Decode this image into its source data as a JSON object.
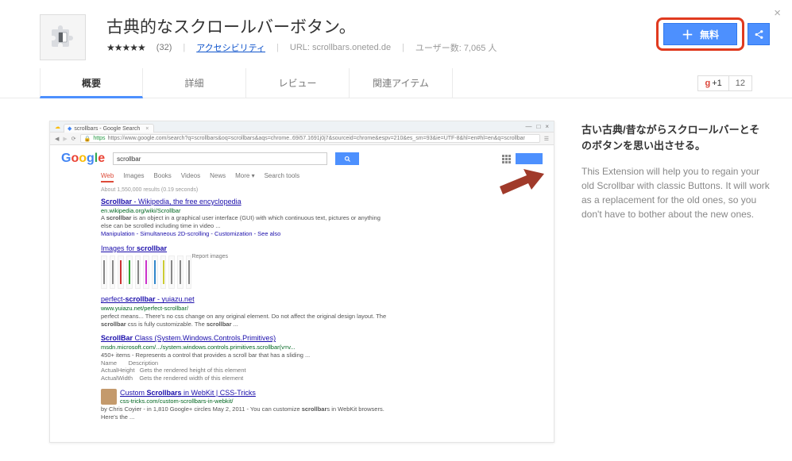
{
  "header": {
    "title": "古典的なスクロールバーボタン。",
    "reviews_count": "(32)",
    "category_link": "アクセシビリティ",
    "url_label": "URL:",
    "url_value": "scrollbars.oneted.de",
    "users_label": "ユーザー数: 7,065 人",
    "install_label": "無料",
    "gplus_label": "+1",
    "gplus_count": "12"
  },
  "tabs": {
    "overview": "概要",
    "details": "詳細",
    "reviews": "レビュー",
    "related": "関連アイテム"
  },
  "screenshot": {
    "tab_title": "scrollbars - Google Search",
    "address_url": "https://www.google.com/search?q=scrollbars&oq=scrollbars&aqs=chrome..69i57.1691j0j7&sourceid=chrome&espv=210&es_sm=93&ie=UTF-8&hl=en#hl=en&q=scrollbar",
    "search_value": "scrollbar",
    "nav": {
      "web": "Web",
      "images": "Images",
      "books": "Books",
      "videos": "Videos",
      "news": "News",
      "more": "More ▾",
      "tools": "Search tools"
    },
    "stats": "About 1,550,000 results (0.19 seconds)",
    "results": [
      {
        "title_before": "",
        "title_bold": "Scrollbar",
        "title_after": " - Wikipedia, the free encyclopedia",
        "url": "en.wikipedia.org/wiki/Scrollbar",
        "desc": "A scrollbar is an object in a graphical user interface (GUI) with which continuous text, pictures or anything else can be scrolled including time in video ...",
        "links": "Manipulation - Simultaneous 2D-scrolling - Customization - See also"
      },
      {
        "title_before": "Images for ",
        "title_bold": "scrollbar",
        "title_after": "",
        "url": "",
        "desc": "",
        "extra": "Report images",
        "images": true
      },
      {
        "title_before": "perfect-",
        "title_bold": "scrollbar",
        "title_after": " - yuiazu.net",
        "url": "www.yuiazu.net/perfect-scrollbar/",
        "desc": "perfect means... There's no css change on any original element. Do not affect the original design layout. The scrollbar css is fully customizable. The scrollbar ..."
      },
      {
        "title_before": "",
        "title_bold": "ScrollBar",
        "title_after": " Class (System.Windows.Controls.Primitives)",
        "url": "msdn.microsoft.com/.../system.windows.controls.primitives.scrollbar(v=v...",
        "desc": "450+ items - Represents a control that provides a scroll bar that has a sliding ...",
        "table": "Name       Description\nActualHeight   Gets the rendered height of this element\nActualWidth    Gets the rendered width of this element"
      },
      {
        "title_before": "Custom ",
        "title_bold": "Scrollbars",
        "title_after": " in WebKit | CSS-Tricks",
        "url": "css-tricks.com/custom-scrollbars-in-webkit/",
        "desc": "by Chris Coyier - in 1,810 Google+ circles\nMay 2, 2011 - You can customize scrollbars in WebKit browsers. Here's the ...",
        "thumb": true
      }
    ]
  },
  "description": {
    "headline": "古い古典/昔ながらスクロールバーとそのボタンを思い出させる。",
    "body": "This Extension will help you to regain your old Scrollbar with classic Buttons. It will work as a replacement for the old ones, so you don't have to bother about the new ones."
  }
}
